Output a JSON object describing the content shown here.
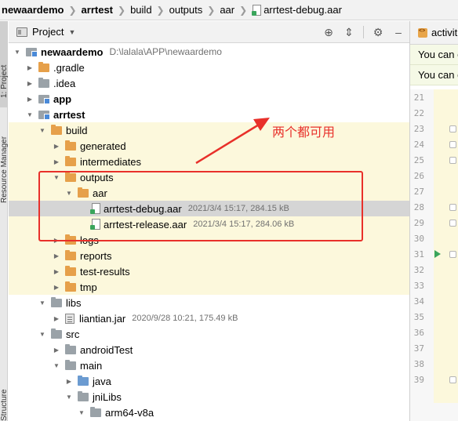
{
  "breadcrumb": {
    "items": [
      "newaardemo",
      "arrtest",
      "build",
      "outputs",
      "aar",
      "arrtest-debug.aar"
    ]
  },
  "left_strip": {
    "tabs": [
      "1: Project",
      "Resource Manager",
      "Structure"
    ]
  },
  "panel": {
    "title": "Project",
    "tools": [
      "locate-icon",
      "collapse-icon",
      "gear-icon",
      "hide-icon"
    ]
  },
  "tree": {
    "rows": [
      {
        "label": "newaardemo",
        "meta": "D:\\lalala\\APP\\newaardemo",
        "icon": "module-folder",
        "bold": true
      },
      {
        "label": ".gradle",
        "meta": "",
        "icon": "folder-orange"
      },
      {
        "label": ".idea",
        "meta": "",
        "icon": "folder-gray"
      },
      {
        "label": "app",
        "meta": "",
        "icon": "module-folder",
        "bold": true
      },
      {
        "label": "arrtest",
        "meta": "",
        "icon": "module-folder",
        "bold": true
      },
      {
        "label": "build",
        "meta": "",
        "icon": "folder-orange"
      },
      {
        "label": "generated",
        "meta": "",
        "icon": "folder-orange"
      },
      {
        "label": "intermediates",
        "meta": "",
        "icon": "folder-orange"
      },
      {
        "label": "outputs",
        "meta": "",
        "icon": "folder-orange"
      },
      {
        "label": "aar",
        "meta": "",
        "icon": "folder-orange"
      },
      {
        "label": "arrtest-debug.aar",
        "meta": "2021/3/4 15:17, 284.15 kB",
        "icon": "aar-file"
      },
      {
        "label": "arrtest-release.aar",
        "meta": "2021/3/4 15:17, 284.06 kB",
        "icon": "aar-file"
      },
      {
        "label": "logs",
        "meta": "",
        "icon": "folder-orange"
      },
      {
        "label": "reports",
        "meta": "",
        "icon": "folder-orange"
      },
      {
        "label": "test-results",
        "meta": "",
        "icon": "folder-orange"
      },
      {
        "label": "tmp",
        "meta": "",
        "icon": "folder-orange"
      },
      {
        "label": "libs",
        "meta": "",
        "icon": "folder-gray"
      },
      {
        "label": "liantian.jar",
        "meta": "2020/9/28 10:21, 175.49 kB",
        "icon": "jar-file"
      },
      {
        "label": "src",
        "meta": "",
        "icon": "folder-gray"
      },
      {
        "label": "androidTest",
        "meta": "",
        "icon": "folder-gray"
      },
      {
        "label": "main",
        "meta": "",
        "icon": "folder-gray"
      },
      {
        "label": "java",
        "meta": "",
        "icon": "folder-blue"
      },
      {
        "label": "jniLibs",
        "meta": "",
        "icon": "folder-gray"
      },
      {
        "label": "arm64-v8a",
        "meta": "",
        "icon": "folder-gray"
      }
    ]
  },
  "annotation": {
    "text": "两个都可用",
    "color": "#e8302a"
  },
  "editor": {
    "tab_label": "activit",
    "notices": [
      "You can c",
      "You can d"
    ],
    "line_numbers": [
      "21",
      "22",
      "23",
      "24",
      "25",
      "26",
      "27",
      "28",
      "29",
      "30",
      "31",
      "32",
      "33",
      "34",
      "35",
      "36",
      "37",
      "38",
      "39"
    ]
  },
  "colors": {
    "highlight_row": "#fcf8dc",
    "selected_row": "#d5d5d5",
    "folder_orange": "#e6a04a",
    "folder_gray": "#9aa2a8",
    "aar_green": "#3aa55c"
  }
}
